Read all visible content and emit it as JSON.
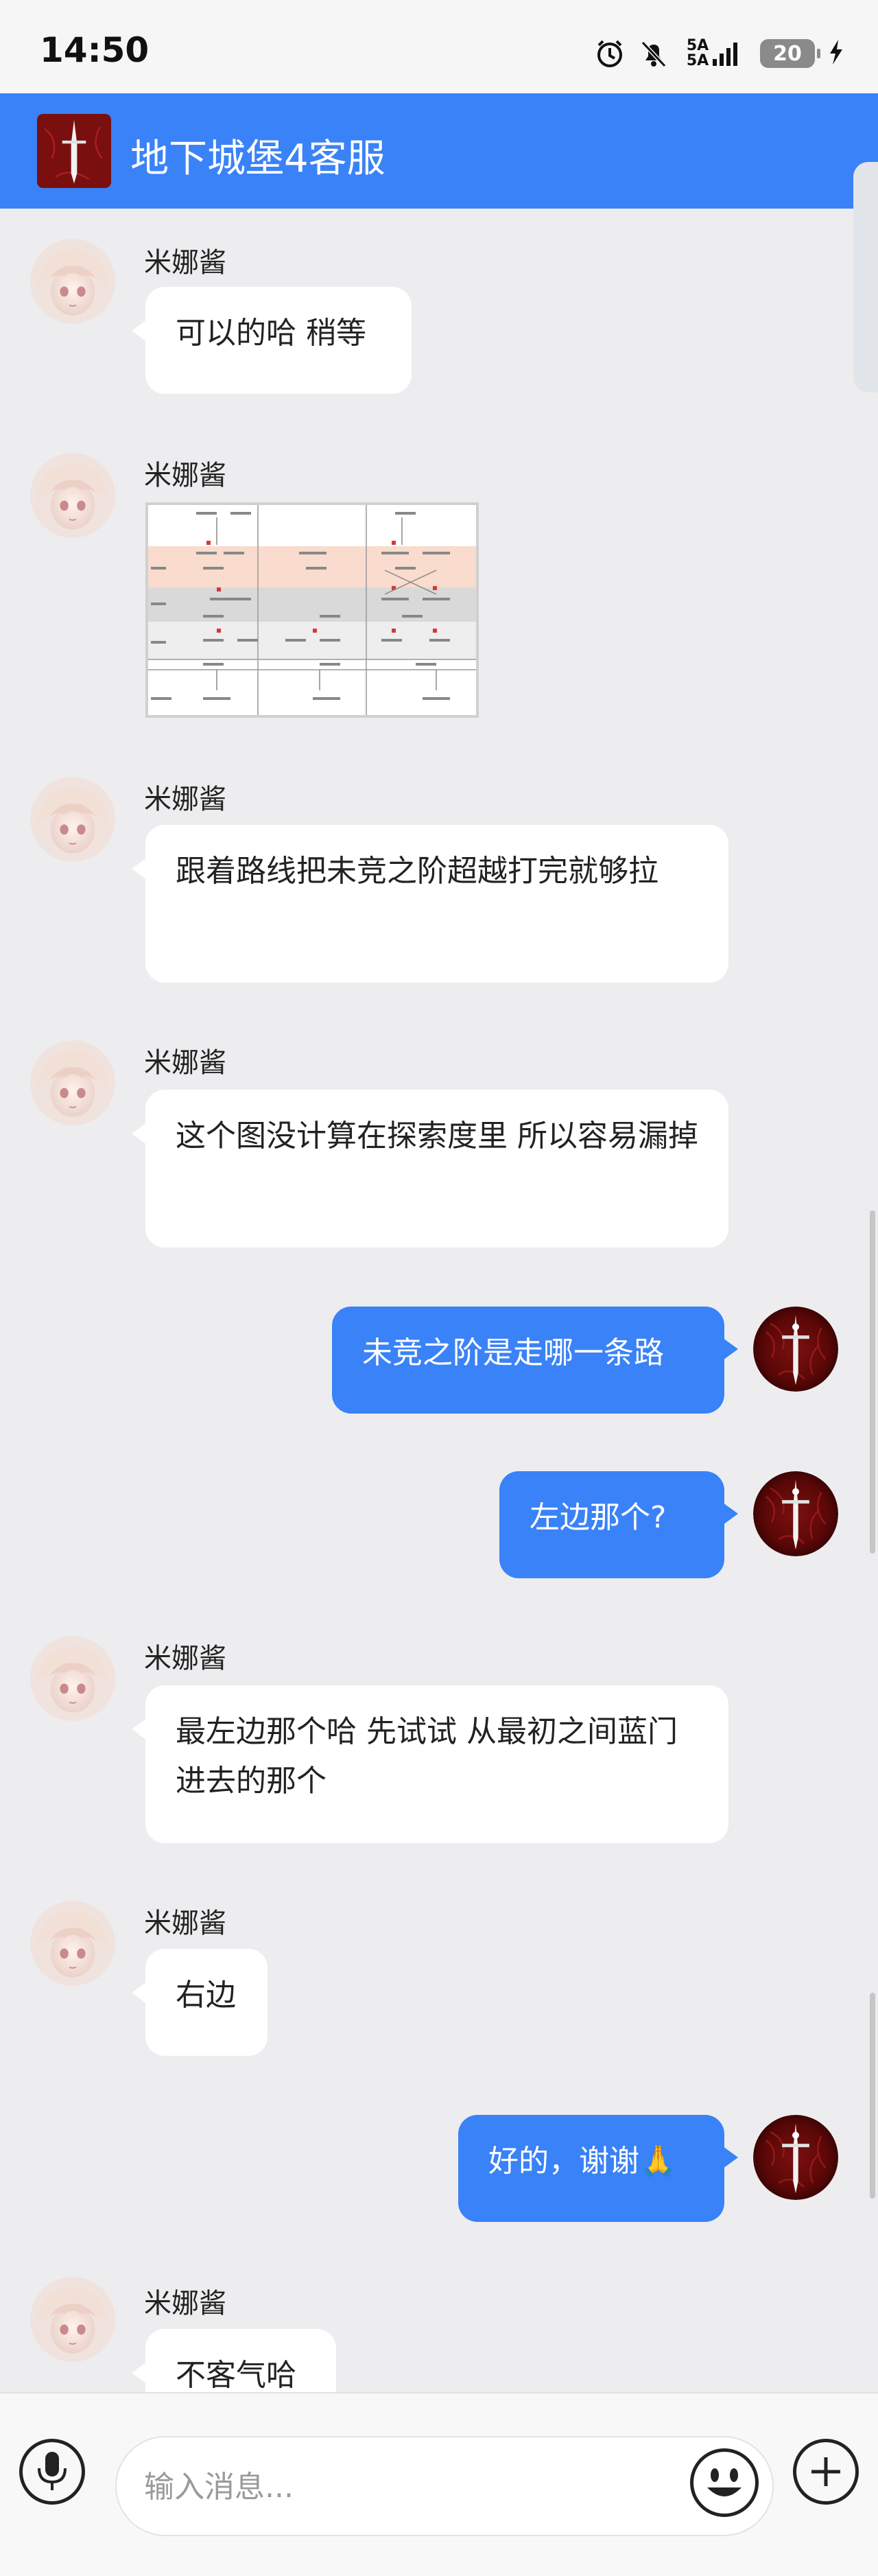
{
  "status_bar": {
    "time": "14:50",
    "network_top": "5A",
    "network_bottom": "5A",
    "battery": "20"
  },
  "header": {
    "title": "地下城堡4客服"
  },
  "messages": [
    {
      "side": "left",
      "sender": "米娜酱",
      "text": "可以的哈 稍等"
    },
    {
      "side": "left",
      "sender": "米娜酱",
      "type": "image"
    },
    {
      "side": "left",
      "sender": "米娜酱",
      "text": "跟着路线把未竞之阶超越打完就够拉"
    },
    {
      "side": "left",
      "sender": "米娜酱",
      "text": "这个图没计算在探索度里 所以容易漏掉"
    },
    {
      "side": "right",
      "text": "未竞之阶是走哪一条路"
    },
    {
      "side": "right",
      "text": "左边那个?"
    },
    {
      "side": "left",
      "sender": "米娜酱",
      "text": "最左边那个哈 先试试 从最初之间蓝门进去的那个"
    },
    {
      "side": "left",
      "sender": "米娜酱",
      "text": "右边"
    },
    {
      "side": "right",
      "text": "好的，谢谢🙏"
    },
    {
      "side": "left",
      "sender": "米娜酱",
      "text": "不客气哈"
    }
  ],
  "input": {
    "placeholder": "输入消息..."
  },
  "icons": {
    "alarm": "alarm-icon",
    "mute": "bell-off-icon",
    "charging": "lightning-icon",
    "mic": "microphone-icon",
    "emoji": "smiley-icon",
    "plus": "plus-icon"
  },
  "colors": {
    "accent": "#3a82f7",
    "background": "#ededef",
    "bubble_left": "#ffffff"
  }
}
